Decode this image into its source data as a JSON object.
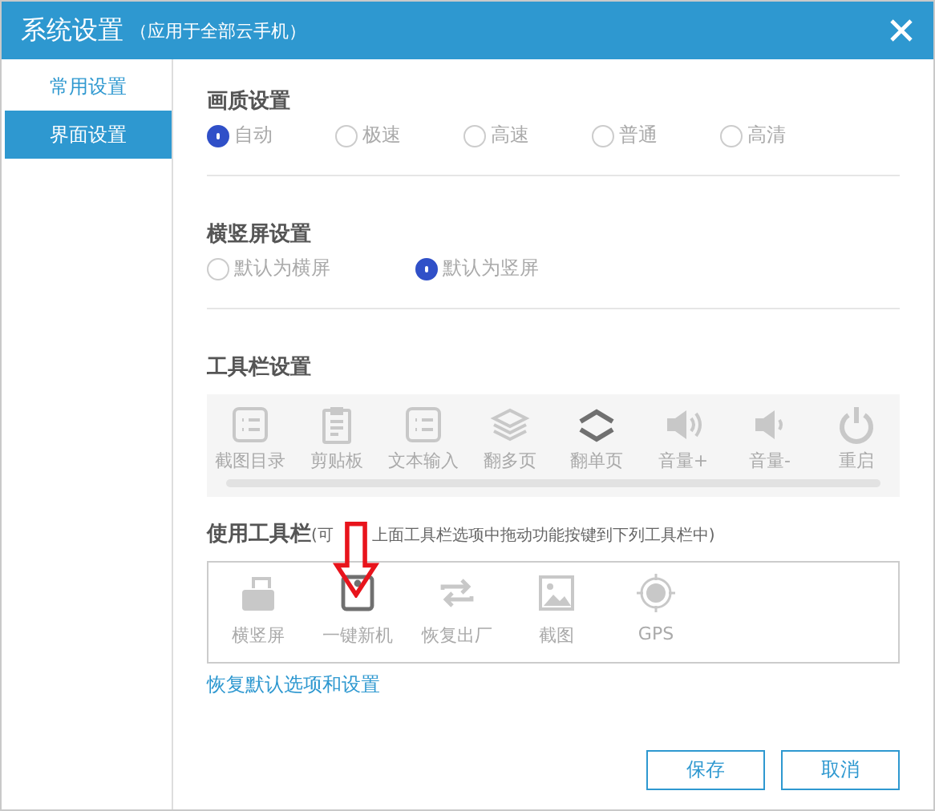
{
  "window": {
    "title": "系统设置",
    "subtitle": "（应用于全部云手机）"
  },
  "sidebar": {
    "items": [
      {
        "label": "常用设置",
        "selected": false
      },
      {
        "label": "界面设置",
        "selected": true
      }
    ]
  },
  "quality": {
    "heading": "画质设置",
    "options": [
      {
        "label": "自动",
        "selected": true
      },
      {
        "label": "极速",
        "selected": false
      },
      {
        "label": "高速",
        "selected": false
      },
      {
        "label": "普通",
        "selected": false
      },
      {
        "label": "高清",
        "selected": false
      }
    ]
  },
  "orientation": {
    "heading": "横竖屏设置",
    "options": [
      {
        "label": "默认为横屏",
        "selected": false
      },
      {
        "label": "默认为竖屏",
        "selected": true
      }
    ]
  },
  "toolbar": {
    "heading": "工具栏设置",
    "items": [
      {
        "label": "截图目录",
        "kind": "list",
        "active": false
      },
      {
        "label": "剪贴板",
        "kind": "clipboard",
        "active": false
      },
      {
        "label": "文本输入",
        "kind": "list",
        "active": false
      },
      {
        "label": "翻多页",
        "kind": "layers",
        "active": false
      },
      {
        "label": "翻单页",
        "kind": "chevrons",
        "active": true
      },
      {
        "label": "音量+",
        "kind": "volup",
        "active": false
      },
      {
        "label": "音量-",
        "kind": "voldown",
        "active": false
      },
      {
        "label": "重启",
        "kind": "power",
        "active": false
      }
    ]
  },
  "used_toolbar": {
    "heading": "使用工具栏",
    "hint_before": "(可",
    "hint_after": "上面工具栏选项中拖动功能按键到下列工具栏中)",
    "items": [
      {
        "label": "横竖屏",
        "kind": "rotate",
        "active": false
      },
      {
        "label": "一键新机",
        "kind": "phone",
        "active": true
      },
      {
        "label": "恢复出厂",
        "kind": "swap",
        "active": false
      },
      {
        "label": "截图",
        "kind": "image",
        "active": false
      },
      {
        "label": "GPS",
        "kind": "gps",
        "active": false
      }
    ]
  },
  "restore_link": "恢复默认选项和设置",
  "buttons": [
    "保存",
    "取消"
  ]
}
